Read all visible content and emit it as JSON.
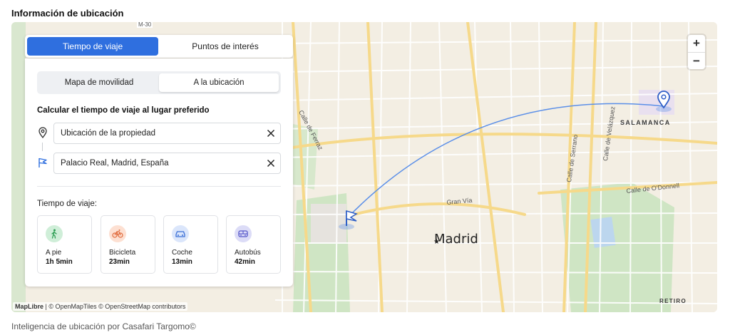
{
  "section_title": "Información de ubicación",
  "tabs": [
    {
      "label": "Tiempo de viaje",
      "active": true
    },
    {
      "label": "Puntos de interés",
      "active": false
    }
  ],
  "mode_toggle": [
    {
      "label": "Mapa de movilidad",
      "active": false
    },
    {
      "label": "A la ubicación",
      "active": true
    }
  ],
  "calc_title": "Calcular el tiempo de viaje al lugar preferido",
  "origin": {
    "value": "Ubicación de la propiedad",
    "icon": "location-pin-icon"
  },
  "destination": {
    "value": "Palacio Real, Madrid, España",
    "icon": "flag-icon"
  },
  "travel_time_label": "Tiempo de viaje:",
  "modes": [
    {
      "name": "A pie",
      "time": "1h 5min",
      "icon": "walk-icon",
      "color": "#cfeed8",
      "icon_color": "#2e9e54"
    },
    {
      "name": "Bicicleta",
      "time": "23min",
      "icon": "bicycle-icon",
      "color": "#fde0d2",
      "icon_color": "#e0693a"
    },
    {
      "name": "Coche",
      "time": "13min",
      "icon": "car-icon",
      "color": "#dbe6fb",
      "icon_color": "#3b6fd6"
    },
    {
      "name": "Autobús",
      "time": "42min",
      "icon": "bus-icon",
      "color": "#dcdcf7",
      "icon_color": "#5557c9"
    }
  ],
  "map": {
    "city_label": "Madrid",
    "district_labels": [
      "SALAMANCA",
      "RETIRO"
    ],
    "street_labels": [
      "Calle de Ferraz",
      "Gran Vía",
      "Calle de Serrano",
      "Calle de Velázquez",
      "Calle de O'Donnell",
      "M-30"
    ],
    "zoom_in": "+",
    "zoom_out": "−",
    "attribution_brand": "MapLibre",
    "attribution_rest": " | © OpenMapTiles © OpenStreetMap contributors",
    "route_color": "#5b8fe8"
  },
  "footer_note": "Inteligencia de ubicación por Casafari Targomo©"
}
